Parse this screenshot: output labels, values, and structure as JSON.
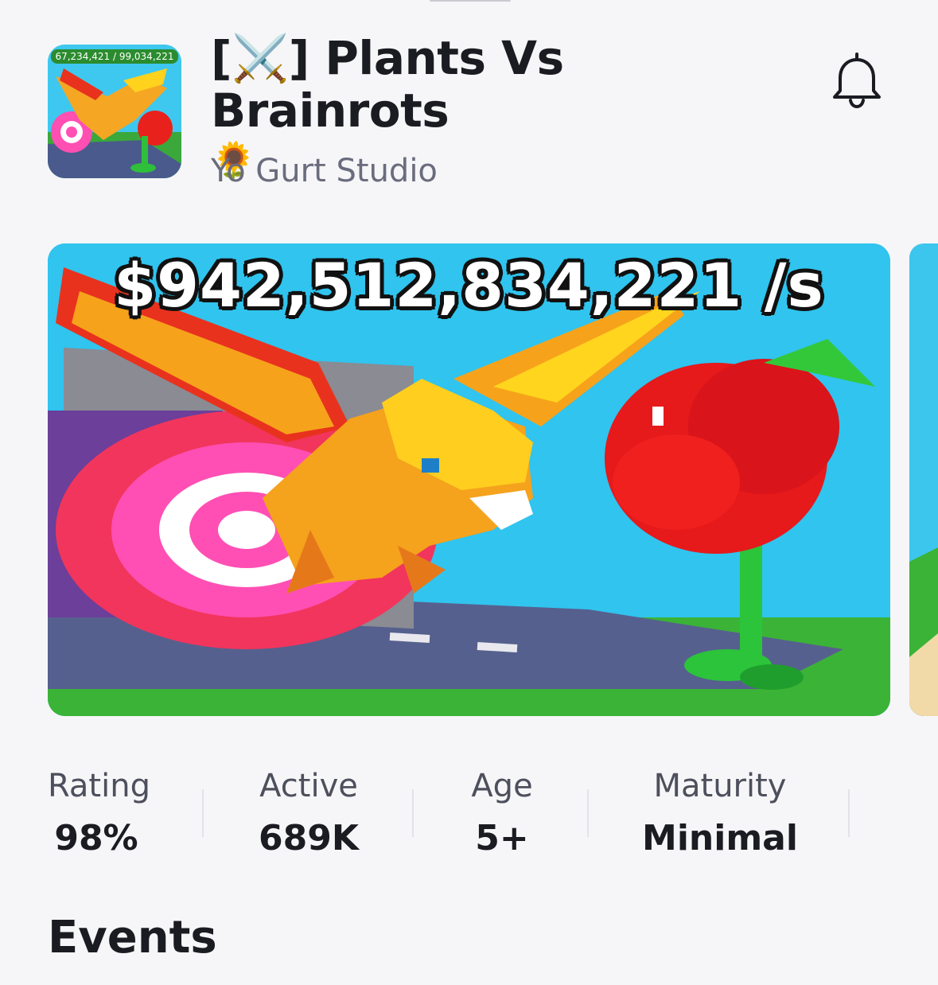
{
  "header": {
    "title": "[⚔️] Plants Vs Brainrots",
    "title_emoji": "🌻",
    "creator": "Yo Gurt Studio",
    "thumb_counter": "67,234,421 / 99,034,221",
    "bell_icon": "bell-icon"
  },
  "carousel": {
    "banner_text": "$942,512,834,221 /s"
  },
  "stats": [
    {
      "label": "Rating",
      "value": "98%"
    },
    {
      "label": "Active",
      "value": "689K"
    },
    {
      "label": "Age",
      "value": "5+"
    },
    {
      "label": "Maturity",
      "value": "Minimal"
    }
  ],
  "events": {
    "title": "Events"
  },
  "colors": {
    "background": "#f6f6f8",
    "text_primary": "#1b1c22",
    "text_secondary": "#6a6c7e"
  }
}
